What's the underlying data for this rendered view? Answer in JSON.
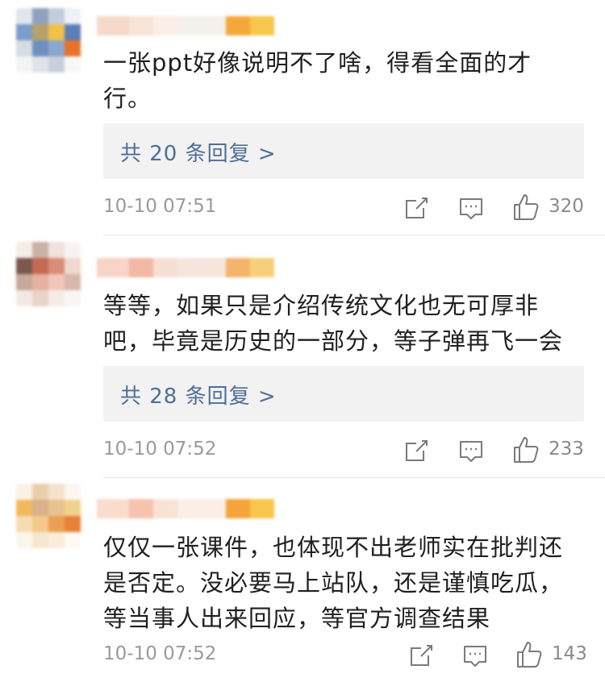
{
  "comments": [
    {
      "text": "一张ppt好像说明不了啥，得看全面的才行。",
      "reply_link": "共 20 条回复 >",
      "time": "10-10 07:51",
      "likes": "320",
      "avatar_colors": [
        "#e0e6ee",
        "#8fa2bd",
        "#c4cedb",
        "#eef1f5",
        "#7c9cc9",
        "#b5a36b",
        "#f2c14a",
        "#5b7fb8",
        "#d7dbe2",
        "#6f8fbf",
        "#8aa7cf",
        "#e8722a",
        "#f3f4f6",
        "#dfe3ea",
        "#c9d0db",
        "#f7f7f7"
      ],
      "name_colors": [
        "#f6d9c9",
        "#f9e3d6",
        "#fbeee6",
        "#f4f0ec",
        "#f5a83a",
        "#f7c64a"
      ]
    },
    {
      "text": "等等，如果只是介绍传统文化也无可厚非吧，毕竟是历史的一部分，等子弹再飞一会",
      "reply_link": "共 28 条回复 >",
      "time": "10-10 07:52",
      "likes": "233",
      "avatar_colors": [
        "#f5ece8",
        "#c9b2a8",
        "#f0e2dc",
        "#f8f3f1",
        "#7a5a4e",
        "#c46a55",
        "#d98c78",
        "#efd8cf",
        "#c7a89b",
        "#e6b1a0",
        "#f2c6b8",
        "#d9b7aa",
        "#f3e9e4",
        "#ead3ca",
        "#f6ece7",
        "#faf6f4"
      ],
      "name_colors": [
        "#f8d4c6",
        "#f2b8a4",
        "#f8dfd3",
        "#f6e5dc",
        "#f5b36b",
        "#f7cf7a"
      ]
    },
    {
      "text": "仅仅一张课件，也体现不出老师实在批判还是否定。没必要马上站队，还是谨慎吃瓜，等当事人出来回应，等官方调查结果",
      "reply_link": "",
      "time": "10-10 07:52",
      "likes": "143",
      "avatar_colors": [
        "#fbf1e6",
        "#e9cfa9",
        "#f4e2cb",
        "#fbf6ef",
        "#f2b85b",
        "#d9b18a",
        "#e7c28e",
        "#f0d28f",
        "#f6dcb0",
        "#f4c98a",
        "#ea9f52",
        "#e8823a",
        "#fcf5ec",
        "#f7e6cf",
        "#f9ecd9",
        "#fdf9f3"
      ],
      "name_colors": [
        "#f9dccc",
        "#f7c3ad",
        "#f9e2d5",
        "#fbeee6",
        "#f5a33a",
        "#f7c64a"
      ]
    }
  ],
  "icons": {
    "share": "share-icon",
    "comment": "comment-icon",
    "like": "like-icon"
  }
}
